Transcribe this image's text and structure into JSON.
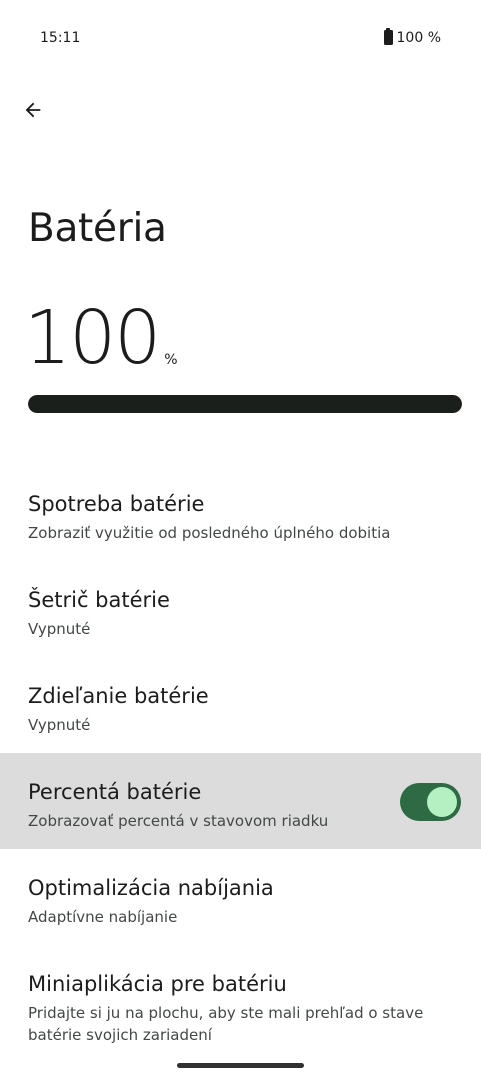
{
  "status_bar": {
    "time": "15:11",
    "battery_text": "100 %",
    "battery_icon": "battery-full-icon"
  },
  "toolbar": {
    "back_icon": "arrow-back-icon"
  },
  "page": {
    "title": "Batéria",
    "level_value": "100",
    "level_unit": "%",
    "level_fraction": 1.0
  },
  "settings": [
    {
      "title": "Spotreba batérie",
      "summary": "Zobraziť využitie od posledného úplného dobitia"
    },
    {
      "title": "Šetrič batérie",
      "summary": "Vypnuté"
    },
    {
      "title": "Zdieľanie batérie",
      "summary": "Vypnuté"
    },
    {
      "title": "Percentá batérie",
      "summary": "Zobrazovať percentá v stavovom riadku",
      "toggle_on": true
    },
    {
      "title": "Optimalizácia nabíjania",
      "summary": "Adaptívne nabíjanie"
    },
    {
      "title": "Miniaplikácia pre batériu",
      "summary": "Pridajte si ju na plochu, aby ste mali prehľad o stave batérie svojich zariadení"
    }
  ],
  "colors": {
    "toggle_track": "#2e6b45",
    "toggle_thumb": "#b4f0c2",
    "highlight": "#dcdcdc",
    "level_fill": "#1b1f1c"
  }
}
